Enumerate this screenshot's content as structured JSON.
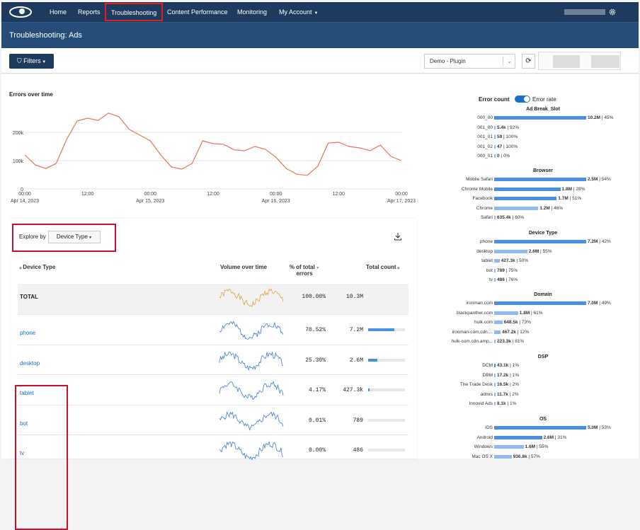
{
  "nav": {
    "items": [
      "Home",
      "Reports",
      "Troubleshooting",
      "Content Performance",
      "Monitoring",
      "My Account"
    ],
    "active": "Troubleshooting"
  },
  "page_title": "Troubleshooting: Ads",
  "toolbar": {
    "filters_label": "Filters",
    "source_select": "Demo - Plugin"
  },
  "chart": {
    "title": "Errors over time",
    "y_ticks": [
      "200k",
      "100k",
      "0"
    ],
    "x_ticks": [
      [
        "00:00",
        "Apr 14, 2023"
      ],
      [
        "12:00",
        ""
      ],
      [
        "00:00",
        "Apr 15, 2023"
      ],
      [
        "12:00",
        ""
      ],
      [
        "00:00",
        "Apr 16, 2023"
      ],
      [
        "12:00",
        ""
      ],
      [
        "00:00",
        "Apr 17, 2023"
      ]
    ],
    "line_color": "#e8735a"
  },
  "chart_data": {
    "type": "line",
    "title": "Errors over time",
    "xlabel": "",
    "ylabel": "",
    "ylim": [
      0,
      250000
    ],
    "x": [
      "Apr 14 00:00",
      "Apr 14 02:00",
      "Apr 14 04:00",
      "Apr 14 06:00",
      "Apr 14 08:00",
      "Apr 14 10:00",
      "Apr 14 12:00",
      "Apr 14 14:00",
      "Apr 14 16:00",
      "Apr 14 18:00",
      "Apr 14 20:00",
      "Apr 14 22:00",
      "Apr 15 00:00",
      "Apr 15 02:00",
      "Apr 15 04:00",
      "Apr 15 06:00",
      "Apr 15 08:00",
      "Apr 15 10:00",
      "Apr 15 12:00",
      "Apr 15 14:00",
      "Apr 15 16:00",
      "Apr 15 18:00",
      "Apr 15 20:00",
      "Apr 15 22:00",
      "Apr 16 00:00",
      "Apr 16 02:00",
      "Apr 16 04:00",
      "Apr 16 06:00",
      "Apr 16 08:00",
      "Apr 16 10:00",
      "Apr 16 12:00",
      "Apr 16 14:00",
      "Apr 16 16:00",
      "Apr 16 18:00",
      "Apr 16 20:00",
      "Apr 16 22:00",
      "Apr 17 00:00"
    ],
    "series": [
      {
        "values": [
          120000,
          85000,
          72000,
          90000,
          175000,
          240000,
          250000,
          242000,
          268000,
          255000,
          210000,
          190000,
          170000,
          120000,
          78000,
          70000,
          90000,
          170000,
          160000,
          158000,
          138000,
          135000,
          150000,
          140000,
          112000,
          72000,
          52000,
          48000,
          80000,
          162000,
          165000,
          150000,
          145000,
          135000,
          155000,
          115000,
          100000
        ]
      }
    ]
  },
  "explore": {
    "label": "Explore by",
    "dimension": "Device Type",
    "headers": {
      "name": "Device Type",
      "volume": "Volume over time",
      "pct1": "% of total",
      "pct2": "errors",
      "count": "Total count"
    },
    "total": {
      "name": "TOTAL",
      "pct": "100.00%",
      "count": "10.3M"
    },
    "rows": [
      {
        "name": "phone",
        "pct": "70.52%",
        "count": "7.2M",
        "fill": 0.7052
      },
      {
        "name": "desktop",
        "pct": "25.30%",
        "count": "2.6M",
        "fill": 0.253
      },
      {
        "name": "tablet",
        "pct": "4.17%",
        "count": "427.3k",
        "fill": 0.0417
      },
      {
        "name": "bot",
        "pct": "0.01%",
        "count": "789",
        "fill": 0.0001
      },
      {
        "name": "tv",
        "pct": "0.00%",
        "count": "486",
        "fill": 0.0
      }
    ]
  },
  "breakdown": {
    "toggle_left": "Error count",
    "toggle_right": "Error rate",
    "sections": [
      {
        "title": "Ad Break_Slot",
        "items": [
          {
            "label": "000_00",
            "value": "10.2M",
            "pct": "45%",
            "fill": 1.0
          },
          {
            "label": "001_00",
            "value": "5.4k",
            "pct": "92%",
            "fill": 0.0
          },
          {
            "label": "001_01",
            "value": "59",
            "pct": "100%",
            "fill": 0.0
          },
          {
            "label": "001_02",
            "value": "47",
            "pct": "100%",
            "fill": 0.0
          },
          {
            "label": "000_01",
            "value": "0",
            "pct": "0%",
            "fill": 0.0
          }
        ]
      },
      {
        "title": "Browser",
        "items": [
          {
            "label": "Mobile Safari",
            "value": "2.5M",
            "pct": "54%",
            "fill": 1.0
          },
          {
            "label": "Chrome Mobile",
            "value": "1.8M",
            "pct": "28%",
            "fill": 0.72
          },
          {
            "label": "Facebook",
            "value": "1.7M",
            "pct": "51%",
            "fill": 0.68
          },
          {
            "label": "Chrome",
            "value": "1.2M",
            "pct": "46%",
            "fill": 0.48
          },
          {
            "label": "Safari",
            "value": "635.4k",
            "pct": "60%",
            "fill": 0.0
          }
        ]
      },
      {
        "title": "Device Type",
        "items": [
          {
            "label": "phone",
            "value": "7.2M",
            "pct": "42%",
            "fill": 1.0
          },
          {
            "label": "desktop",
            "value": "2.6M",
            "pct": "55%",
            "fill": 0.36
          },
          {
            "label": "tablet",
            "value": "427.3k",
            "pct": "50%",
            "fill": 0.06
          },
          {
            "label": "bot",
            "value": "789",
            "pct": "75%",
            "fill": 0.0
          },
          {
            "label": "tv",
            "value": "486",
            "pct": "76%",
            "fill": 0.0
          }
        ]
      },
      {
        "title": "Domain",
        "items": [
          {
            "label": "ironman.com",
            "value": "7.0M",
            "pct": "49%",
            "fill": 1.0
          },
          {
            "label": "blackpanther.com",
            "value": "1.8M",
            "pct": "61%",
            "fill": 0.26
          },
          {
            "label": "hulk.com",
            "value": "648.5k",
            "pct": "73%",
            "fill": 0.09
          },
          {
            "label": "ironman-com.cdn....",
            "value": "467.2k",
            "pct": "12%",
            "fill": 0.07
          },
          {
            "label": "hulk-com.cdn.amp...",
            "value": "223.3k",
            "pct": "81%",
            "fill": 0.0
          }
        ]
      },
      {
        "title": "DSP",
        "items": [
          {
            "label": "DCM",
            "value": "43.1k",
            "pct": "1%",
            "fill": 0.0
          },
          {
            "label": "DBM",
            "value": "17.2k",
            "pct": "1%",
            "fill": 0.0
          },
          {
            "label": "The Trade Desk",
            "value": "16.5k",
            "pct": "2%",
            "fill": 0.0
          },
          {
            "label": "adnxs",
            "value": "11.7k",
            "pct": "2%",
            "fill": 0.0
          },
          {
            "label": "Innovid Ads",
            "value": "8.1k",
            "pct": "1%",
            "fill": 0.0
          }
        ]
      },
      {
        "title": "OS",
        "items": [
          {
            "label": "iOS",
            "value": "5.0M",
            "pct": "53%",
            "fill": 1.0
          },
          {
            "label": "Android",
            "value": "2.6M",
            "pct": "31%",
            "fill": 0.52
          },
          {
            "label": "Windows",
            "value": "1.6M",
            "pct": "55%",
            "fill": 0.32
          },
          {
            "label": "Mac OS X",
            "value": "936.8k",
            "pct": "57%",
            "fill": 0.19
          }
        ]
      }
    ]
  }
}
